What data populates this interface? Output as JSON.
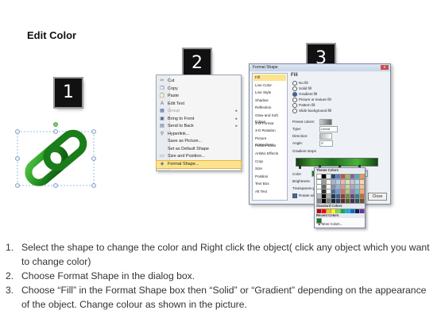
{
  "title": "Edit Color",
  "badges": [
    "1",
    "2",
    "3"
  ],
  "context_menu": {
    "items": [
      {
        "label": "Cut",
        "icon": "scissors-icon",
        "glyph": "✂"
      },
      {
        "label": "Copy",
        "icon": "copy-icon",
        "glyph": "❐"
      },
      {
        "label": "Paste",
        "icon": "paste-icon",
        "glyph": "📋"
      },
      {
        "label": "Edit Text",
        "icon": "edit-text-icon",
        "glyph": "A"
      },
      {
        "label": "Group",
        "icon": "group-icon",
        "glyph": "▦",
        "disabled": true,
        "submenu": true
      },
      {
        "label": "Bring to Front",
        "icon": "bring-front-icon",
        "glyph": "▣",
        "submenu": true
      },
      {
        "label": "Send to Back",
        "icon": "send-back-icon",
        "glyph": "▤",
        "submenu": true
      },
      {
        "label": "Hyperlink...",
        "icon": "hyperlink-icon",
        "glyph": "⚲"
      },
      {
        "label": "Save as Picture...",
        "icon": "",
        "glyph": ""
      },
      {
        "label": "Set as Default Shape",
        "icon": "",
        "glyph": ""
      },
      {
        "label": "Size and Position...",
        "icon": "size-position-icon",
        "glyph": "▭"
      },
      {
        "label": "Format Shape...",
        "icon": "format-shape-icon",
        "glyph": "◈",
        "highlighted": true
      }
    ]
  },
  "dialog": {
    "title": "Format Shape",
    "close": "x",
    "sidebar": [
      "Fill",
      "Line Color",
      "Line Style",
      "Shadow",
      "Reflection",
      "Glow and Soft Edges",
      "3-D Format",
      "3-D Rotation",
      "Picture Corrections",
      "Picture Color",
      "Artistic Effects",
      "Crop",
      "Size",
      "Position",
      "Text Box",
      "Alt Text"
    ],
    "pane_title": "Fill",
    "fill_options": [
      {
        "label": "No fill",
        "on": false
      },
      {
        "label": "Solid fill",
        "on": false
      },
      {
        "label": "Gradient fill",
        "on": true
      },
      {
        "label": "Picture or texture fill",
        "on": false
      },
      {
        "label": "Pattern fill",
        "on": false
      },
      {
        "label": "Slide background fill",
        "on": false
      }
    ],
    "fields": {
      "preset": "Preset colors:",
      "type": "Type:",
      "type_value": "Linear",
      "direction": "Direction:",
      "angle": "Angle:",
      "angle_value": "0°",
      "stops": "Gradient stops",
      "color": "Color",
      "position": "Position:",
      "position_value": "0%",
      "brightness": "Brightness:",
      "transparency": "Transparency:",
      "rotate": "Rotate with shape"
    },
    "close_button": "Close"
  },
  "color_picker": {
    "theme_header": "Theme Colors",
    "standard_header": "Standard Colors",
    "recent_header": "Recent Colors",
    "more": "More Colors...",
    "theme_colors": [
      "#ffffff",
      "#000000",
      "#eeece1",
      "#1f497d",
      "#4f81bd",
      "#c0504d",
      "#9bbb59",
      "#8064a2",
      "#4bacc6",
      "#f79646"
    ],
    "standard_colors": [
      "#c00000",
      "#ff0000",
      "#ffc000",
      "#ffff00",
      "#92d050",
      "#00b050",
      "#00b0f0",
      "#0070c0",
      "#002060",
      "#7030a0"
    ],
    "recent_colors": [
      "#1b7a1b"
    ]
  },
  "steps": [
    "Select the shape to change the color and Right click the object( click any object which you want to change color)",
    "Choose Format Shape in the dialog box.",
    "Choose “Fill” in the Format Shape box then “Solid” or “Gradient” depending on the appearance of the object. Change colour as shown in the picture."
  ]
}
